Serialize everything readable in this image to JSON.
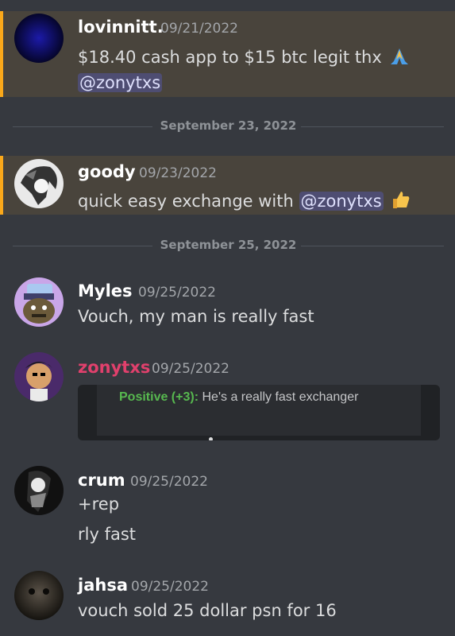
{
  "messages": [
    {
      "author": "lovinnitt.",
      "timestamp": "09/21/2022",
      "text": "$18.40 cash app to $15 btc legit thx",
      "emoji": "folded-hands",
      "mention": "@zonytxs"
    },
    {
      "author": "goody",
      "timestamp": "09/23/2022",
      "text": "quick easy exchange with",
      "mention": "@zonytxs",
      "emoji": "thumbs-up"
    },
    {
      "author": "Myles",
      "timestamp": "09/25/2022",
      "text": "Vouch, my man is really fast"
    },
    {
      "author": "zonytxs",
      "timestamp": "09/25/2022",
      "author_color": "#e0406c",
      "embed": {
        "label": "Positive (+3):",
        "text": "He's a really fast exchanger"
      }
    },
    {
      "author": "crum",
      "timestamp": "09/25/2022",
      "lines": [
        "+rep",
        "rly fast"
      ]
    },
    {
      "author": "jahsa",
      "timestamp": "09/25/2022",
      "text": "vouch sold 25 dollar psn for 16"
    }
  ],
  "dividers": [
    "September 23, 2022",
    "September 25, 2022"
  ],
  "colors": {
    "background": "#36393f",
    "highlight": "#49443c",
    "highlight_bar": "#faa81a",
    "mention_bg": "#4a4f79",
    "positive": "#57b84f"
  }
}
